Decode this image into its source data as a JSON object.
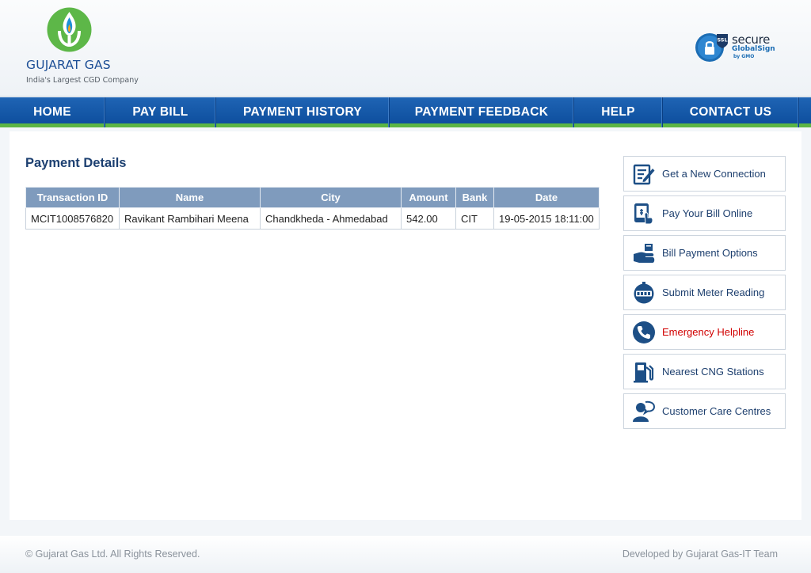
{
  "header": {
    "brand_name": "GUJARAT GAS",
    "tagline": "India's Largest CGD Company",
    "ssl": {
      "badge": "SSL",
      "word": "secure",
      "provider": "GlobalSign",
      "by": "by GMO"
    }
  },
  "nav": {
    "items": [
      {
        "label": "HOME"
      },
      {
        "label": "PAY BILL"
      },
      {
        "label": "PAYMENT HISTORY"
      },
      {
        "label": "PAYMENT FEEDBACK"
      },
      {
        "label": "HELP"
      },
      {
        "label": "CONTACT US"
      }
    ]
  },
  "main": {
    "title": "Payment Details",
    "table": {
      "headers": [
        "Transaction ID",
        "Name",
        "City",
        "Amount",
        "Bank",
        "Date"
      ],
      "rows": [
        [
          "MCIT1008576820",
          "Ravikant Rambihari Meena",
          "Chandkheda - Ahmedabad",
          "542.00",
          "CIT",
          "19-05-2015 18:11:00"
        ]
      ]
    }
  },
  "sidebar": {
    "items": [
      {
        "label": "Get a New Connection",
        "icon": "new-connection-icon"
      },
      {
        "label": "Pay Your Bill Online",
        "icon": "pay-online-icon"
      },
      {
        "label": "Bill Payment Options",
        "icon": "payment-options-icon"
      },
      {
        "label": "Submit Meter Reading",
        "icon": "meter-icon"
      },
      {
        "label": "Emergency Helpline",
        "icon": "phone-icon"
      },
      {
        "label": "Nearest CNG Stations",
        "icon": "fuel-pump-icon"
      },
      {
        "label": "Customer Care Centres",
        "icon": "customer-care-icon"
      }
    ]
  },
  "footer": {
    "copyright": "© Gujarat Gas Ltd.  All Rights Reserved.",
    "credit": "Developed by Gujarat Gas-IT Team"
  },
  "colors": {
    "nav_blue": "#1f64b4",
    "nav_green": "#5bb544",
    "heading_navy": "#1d4071",
    "table_header": "#7f9bbd",
    "emergency_red": "#d10000"
  }
}
